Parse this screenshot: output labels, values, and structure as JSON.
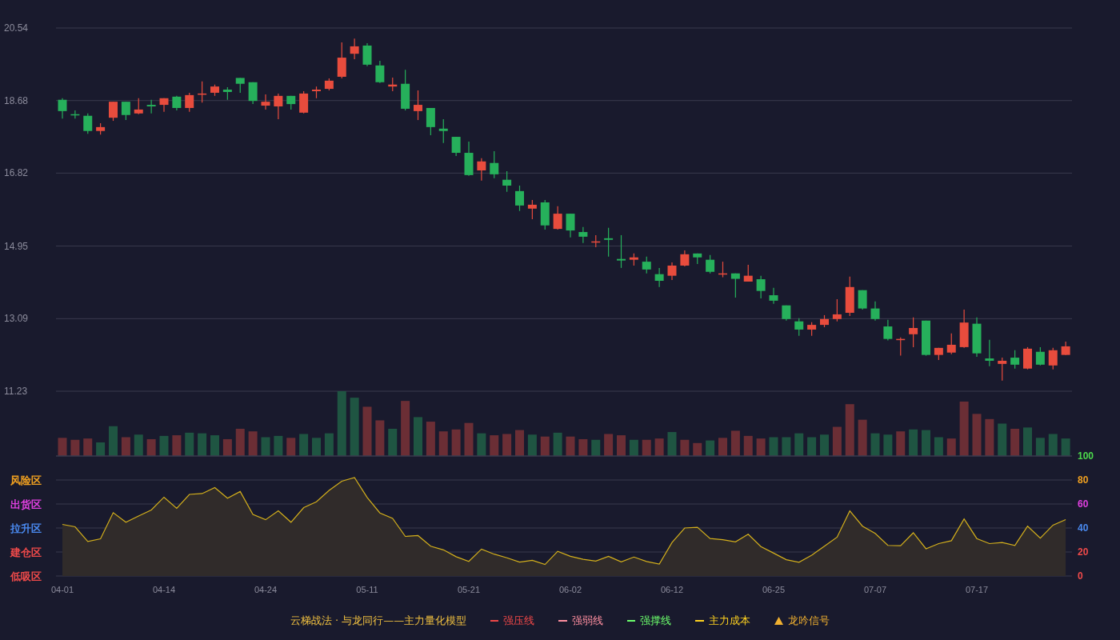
{
  "price_chart": {
    "chart_data": {
      "type": "candlestick",
      "ylim": [
        11.23,
        20.54
      ],
      "yticks": [
        20.54,
        18.68,
        16.82,
        14.95,
        13.09,
        11.23
      ],
      "grid": true,
      "ohlc": [
        [
          18.7,
          18.74,
          18.22,
          18.41
        ],
        [
          18.33,
          18.43,
          18.22,
          18.31
        ],
        [
          18.29,
          18.35,
          17.83,
          17.9
        ],
        [
          17.9,
          18.1,
          17.81,
          18.0
        ],
        [
          18.24,
          18.65,
          18.16,
          18.65
        ],
        [
          18.65,
          18.65,
          18.18,
          18.31
        ],
        [
          18.35,
          18.74,
          18.33,
          18.45
        ],
        [
          18.57,
          18.7,
          18.35,
          18.53
        ],
        [
          18.57,
          18.74,
          18.39,
          18.74
        ],
        [
          18.78,
          18.8,
          18.43,
          18.49
        ],
        [
          18.49,
          18.88,
          18.39,
          18.82
        ],
        [
          18.84,
          19.17,
          18.63,
          18.86
        ],
        [
          18.88,
          19.09,
          18.8,
          19.04
        ],
        [
          18.96,
          19.02,
          18.7,
          18.9
        ],
        [
          19.26,
          19.26,
          18.88,
          19.11
        ],
        [
          19.15,
          19.15,
          18.59,
          18.67
        ],
        [
          18.55,
          18.84,
          18.45,
          18.65
        ],
        [
          18.53,
          18.86,
          18.2,
          18.8
        ],
        [
          18.8,
          18.8,
          18.45,
          18.59
        ],
        [
          18.37,
          18.92,
          18.35,
          18.86
        ],
        [
          18.92,
          19.04,
          18.74,
          18.96
        ],
        [
          18.98,
          19.25,
          18.94,
          19.19
        ],
        [
          19.29,
          20.17,
          19.25,
          19.78
        ],
        [
          19.88,
          20.27,
          19.74,
          20.07
        ],
        [
          20.09,
          20.15,
          19.56,
          19.6
        ],
        [
          19.58,
          19.7,
          19.13,
          19.15
        ],
        [
          19.04,
          19.27,
          18.92,
          19.09
        ],
        [
          19.11,
          19.47,
          18.43,
          18.47
        ],
        [
          18.41,
          18.94,
          18.18,
          18.57
        ],
        [
          18.49,
          18.49,
          17.79,
          18.0
        ],
        [
          17.96,
          18.2,
          17.59,
          17.9
        ],
        [
          17.75,
          17.75,
          17.26,
          17.34
        ],
        [
          17.34,
          17.63,
          16.75,
          16.77
        ],
        [
          16.89,
          17.2,
          16.63,
          17.12
        ],
        [
          17.08,
          17.38,
          16.69,
          16.79
        ],
        [
          16.65,
          16.87,
          16.34,
          16.5
        ],
        [
          16.36,
          16.5,
          15.85,
          15.99
        ],
        [
          15.91,
          16.13,
          15.64,
          16.01
        ],
        [
          16.07,
          16.13,
          15.37,
          15.48
        ],
        [
          15.39,
          15.97,
          15.37,
          15.78
        ],
        [
          15.78,
          15.78,
          15.17,
          15.35
        ],
        [
          15.31,
          15.44,
          15.03,
          15.19
        ],
        [
          15.05,
          15.23,
          14.92,
          15.07
        ],
        [
          15.15,
          15.42,
          14.68,
          15.11
        ],
        [
          14.62,
          15.23,
          14.39,
          14.58
        ],
        [
          14.6,
          14.76,
          14.45,
          14.66
        ],
        [
          14.55,
          14.68,
          14.25,
          14.35
        ],
        [
          14.23,
          14.39,
          13.9,
          14.06
        ],
        [
          14.19,
          14.53,
          14.08,
          14.45
        ],
        [
          14.45,
          14.84,
          14.43,
          14.74
        ],
        [
          14.76,
          14.76,
          14.49,
          14.66
        ],
        [
          14.6,
          14.72,
          14.25,
          14.29
        ],
        [
          14.23,
          14.55,
          14.15,
          14.25
        ],
        [
          14.25,
          14.25,
          13.63,
          14.11
        ],
        [
          14.04,
          14.47,
          14.04,
          14.19
        ],
        [
          14.1,
          14.19,
          13.61,
          13.8
        ],
        [
          13.69,
          13.88,
          13.47,
          13.55
        ],
        [
          13.43,
          13.43,
          13.04,
          13.08
        ],
        [
          13.02,
          13.1,
          12.65,
          12.81
        ],
        [
          12.81,
          13.0,
          12.65,
          12.93
        ],
        [
          12.93,
          13.18,
          12.87,
          13.08
        ],
        [
          13.08,
          13.59,
          13.02,
          13.2
        ],
        [
          13.24,
          14.17,
          13.16,
          13.9
        ],
        [
          13.82,
          13.82,
          13.32,
          13.35
        ],
        [
          13.35,
          13.53,
          13.04,
          13.08
        ],
        [
          12.89,
          13.06,
          12.53,
          12.57
        ],
        [
          12.55,
          12.61,
          12.14,
          12.57
        ],
        [
          12.69,
          13.12,
          12.36,
          12.85
        ],
        [
          13.04,
          13.04,
          12.14,
          12.16
        ],
        [
          12.16,
          12.34,
          12.03,
          12.34
        ],
        [
          12.22,
          12.71,
          12.18,
          12.42
        ],
        [
          12.36,
          13.32,
          12.34,
          12.99
        ],
        [
          12.96,
          13.12,
          12.11,
          12.2
        ],
        [
          12.07,
          12.55,
          11.87,
          12.01
        ],
        [
          11.93,
          12.09,
          11.5,
          12.01
        ],
        [
          12.09,
          12.28,
          11.81,
          11.91
        ],
        [
          11.81,
          12.36,
          11.79,
          12.32
        ],
        [
          12.24,
          12.36,
          11.89,
          11.91
        ],
        [
          11.89,
          12.34,
          11.79,
          12.28
        ],
        [
          12.16,
          12.5,
          12.16,
          12.38
        ]
      ]
    }
  },
  "indicator_chart": {
    "zones": [
      {
        "label": "风险区",
        "color": "#f0a020"
      },
      {
        "label": "出货区",
        "color": "#e040e0"
      },
      {
        "label": "拉升区",
        "color": "#4a8af0"
      },
      {
        "label": "建仓区",
        "color": "#f04a4a"
      },
      {
        "label": "低吸区",
        "color": "#f04a4a"
      }
    ],
    "right_axis": [
      {
        "label": "100",
        "color": "#4cd94c"
      },
      {
        "label": "80",
        "color": "#f0a020"
      },
      {
        "label": "60",
        "color": "#e040e0"
      },
      {
        "label": "40",
        "color": "#4a8af0"
      },
      {
        "label": "20",
        "color": "#f04a4a"
      },
      {
        "label": "0",
        "color": "#f04a4a"
      }
    ],
    "chart_data": {
      "type": "area",
      "grid": true,
      "ylim": [
        0,
        100
      ],
      "yticks": [
        100,
        80,
        60,
        40,
        20,
        0
      ],
      "categories": [
        "04-01",
        null,
        null,
        null,
        null,
        null,
        null,
        null,
        "04-14",
        null,
        null,
        null,
        null,
        null,
        null,
        null,
        "04-24",
        null,
        null,
        null,
        null,
        null,
        null,
        null,
        "05-11",
        null,
        null,
        null,
        null,
        null,
        null,
        null,
        "05-21",
        null,
        null,
        null,
        null,
        null,
        null,
        null,
        "06-02",
        null,
        null,
        null,
        null,
        null,
        null,
        null,
        "06-12",
        null,
        null,
        null,
        null,
        null,
        null,
        null,
        "06-25",
        null,
        null,
        null,
        null,
        null,
        null,
        null,
        "07-07",
        null,
        null,
        null,
        null,
        null,
        null,
        null,
        "07-17",
        null,
        null,
        null,
        null,
        null,
        null,
        null
      ],
      "series": [
        {
          "color": "#d4b01c",
          "values": [
            43,
            41,
            28.7,
            31,
            52.8,
            44.8,
            50,
            55,
            65.7,
            56.4,
            68,
            68.7,
            73.7,
            64.8,
            70.4,
            51.3,
            46.9,
            54.3,
            44.8,
            57,
            61.8,
            71.3,
            79,
            82,
            65.4,
            52.5,
            48,
            33,
            33.7,
            24.8,
            21.8,
            16.1,
            12.2,
            22.4,
            18.2,
            15.2,
            11.6,
            13.1,
            9.6,
            20.6,
            16.4,
            13.9,
            12.4,
            16.4,
            11.8,
            15.8,
            12.1,
            10,
            27.9,
            40,
            40.6,
            31.2,
            30.3,
            28.5,
            34.8,
            24.5,
            19.1,
            13.6,
            11.5,
            17.3,
            24.8,
            32.4,
            54.2,
            41.5,
            35.5,
            25.5,
            25.2,
            36,
            22.7,
            27,
            29.4,
            47.6,
            31.2,
            27,
            27.9,
            25.5,
            41.5,
            31.5,
            42.4,
            47
          ]
        }
      ]
    }
  },
  "legend": {
    "title": "云梯战法 · 与龙同行——主力量化模型",
    "items": [
      {
        "label": "强压线",
        "kind": "line",
        "color": "#f04848"
      },
      {
        "label": "强弱线",
        "kind": "dash",
        "color": "#ff8fa0"
      },
      {
        "label": "强撑线",
        "kind": "line",
        "color": "#6cff6c"
      },
      {
        "label": "主力成本",
        "kind": "dash",
        "color": "#ffd21f"
      },
      {
        "label": "龙吟信号",
        "kind": "triangle",
        "color": "#f0b030"
      }
    ]
  }
}
